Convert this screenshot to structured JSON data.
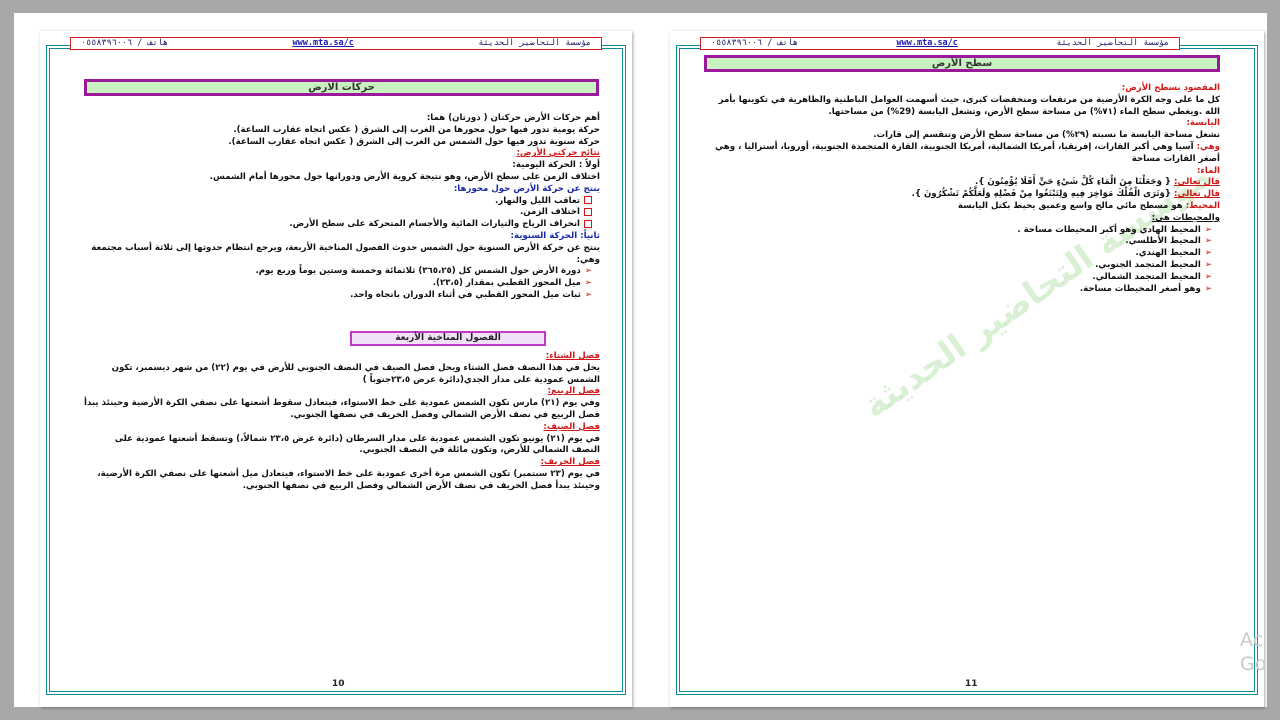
{
  "header": {
    "org": "مؤسسة التحاضير الحديثة",
    "url": "www.mta.sa/c",
    "phone": "هاتف / ٠٥٥٨٣٩٦٠٠٦"
  },
  "left_page": {
    "title": "حركات الارض",
    "lines": [
      "أهم حركات الأرض حركتان ( دورتان) هما:",
      "حركة يومية تدور فيها حول محورها من الغرب إلى الشرق ( عكس اتجاه عقارب الساعة).",
      "حركة سنوية تدور فيها حول الشمس من الغرب إلى الشرق  ( عكس اتجاه عقارب الساعة).",
      "نتائج حركتي الأرض:",
      "أولاً : الحركة اليومية:",
      "اختلاف الزمن على سطح الأرض، وهو نتيجة كروية الأرض ودورانها حول محورها أمام الشمس.",
      "ينتج  عن حركة الأرض حول محورها:",
      "تعاقب الليل والنهار.",
      "اختلاف الزمن.",
      "انحراف الرياح والتيارات المائية والأجسام المتحركة على سطح الأرض.",
      "ثانياً: الحركة السنوية:",
      "ينتج عن حركة الأرض السنوية حول الشمس حدوث الفصول المناخية الأربعة، ويرجع  انتظام حدوثها إلى ثلاثة أسباب مجتمعة وهي:",
      "دورة الأرض حول الشمس كل (٣٦٥،٢٥) ثلاثمائة وخمسة وستين يوماً وربع  يوم.",
      "ميل المحور القطبي بمقدار (٢٣،٥).",
      "ثبات ميل المحور القطبي في أثناء الدوران باتجاه واحد."
    ],
    "seasons_title": "الفصول المناخية الأربعة",
    "seasons": [
      {
        "name": "فصل الشتاء:",
        "text": "يحل في هذا  النصف فصل الشتاء ويحل فصل الصيف في النصف الجنوبي للأرض في يوم (٢٢) من شهر ديسمبر، تكون الشمس عمودية على مدار الجدي(دائرة عرض ٢٣،٥جنوباً )"
      },
      {
        "name": "فصل الربيع:",
        "text": "وفي يوم (٢١) مارس تكون الشمس عمودية  على خط الاستواء، فيتعادل سقوط أشعتها على نصفي الكرة الأرضية وحينئذ يبدأ فصل الربيع في نصف الأرض الشمالي وفصل الخريف في نصفها الجنوبي."
      },
      {
        "name": "فصل الصيف:",
        "text": "في يوم (٢١) يونيو  تكون الشمس عمودية  على مدار السرطان (دائرة عرض ٢٣،٥ شمالاً،) وتسقط أشعتها عمودية على النصف الشمالي  للأرض، وتكون مائلة في النصف الجنوبي."
      },
      {
        "name": "فصل الخريف:",
        "text": "في يوم (٢٣ سبتمبر) تكون الشمس مرة أخرى  عمودية على خط الاستواء، فيتعادل ميل أشعتها على نصفي الكرة الأرضية، وحينئذ يبدأ فصل الخريف في نصف الأرض الشمالي وفصل الربيع في نصفها الجنوبي."
      }
    ],
    "page_number": "10"
  },
  "right_page": {
    "title": "سطح الأرض",
    "intro_heading": "المقصود بسطح الأرض:",
    "intro": "كل ما على وجه الكرة الأرضية من مرتفعات ومنخفضات كبرى، حيث أسهمت العوامل الباطنية والظاهرية في تكوينها بأمر الله .ويغطي سطح الماء (٧١%) من مساحة  سطح  الأرض، وتشغل اليابسة (29%) من مساحتها.",
    "land_heading": "اليابسة:",
    "land": "تشغل مساحة اليابسة ما نسبته (٢٩%) من مساحة سطح الأرض وتنقسم إلى قارات.",
    "continents_label": "وهي:",
    "continents": "آسيا وهي أكبر القارات، إفريقيا، أمريكا الشمالية، أمريكا الجنوبية، القارة المتجمدة الجنوبية، أوروبا، أستراليا ، وهي أصغر القارات مساحة",
    "water_heading": "الماء:",
    "quran1_label": "قال تعالى:",
    "quran1": "{ وَجَعَلْنَا مِنَ الْمَاءِ كُلَّ شَيْءٍ حَيٍّ أَفَلَا يُؤْمِنُونَ }.",
    "quran2_label": "قال تعالى:",
    "quran2": "{وَتَرَى الْفُلْكَ مَوَاخِرَ فِيهِ وَلِتَبْتَغُوا مِنْ فَضْلِهِ وَلَعَلَّكُمْ تَشْكُرُونَ }.",
    "ocean_label": "المحيط:",
    "ocean": " هو مسطح مائي مالح واسع وعميق يحيط بكتل اليابسة",
    "oceans_heading": "والمحيطات هي:",
    "oceans": [
      "المحيط الهادي وهو أكبر المحيطات مساحة .",
      "المحيط الأطلسي.",
      "المحيط الهندي.",
      "المحيط المتجمد الجنوبي.",
      "المحيط المتجمد الشمالي.",
      "وهو أصغر المحيطات مساحة."
    ],
    "watermark": "مؤسسة التحاضير الحديثة",
    "page_number": "11"
  },
  "overlay": {
    "activate_text": "Ac\nGo"
  },
  "colors": {
    "frame": "#a8a8a8",
    "border": "#0c8c92",
    "title_bg": "#c8f3c0",
    "title_border": "#9b1a9b",
    "red": "#d01818",
    "blue": "#1a2aa8"
  }
}
